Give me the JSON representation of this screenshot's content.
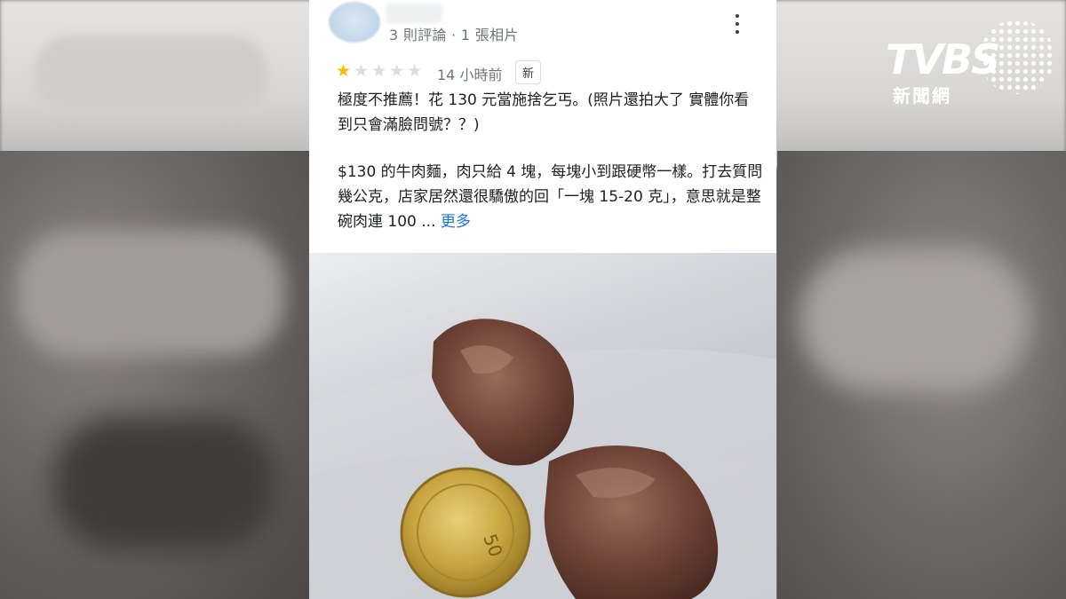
{
  "review": {
    "meta": "3 則評論 · 1 張相片",
    "rating": 1,
    "max_rating": 5,
    "time": "14 小時前",
    "badge": "新",
    "text_line1": "極度不推薦！花 130 元當施捨乞丐。(照片還拍大了 實體你看到只會滿臉問號？？)",
    "text_line2": "$130 的牛肉麵，肉只給 4 塊，每塊小到跟硬幣一樣。打去質問幾公克，店家居然還很驕傲的回「一塊 15-20 克」，意思就是整碗肉連 100 ...",
    "more_label": "更多",
    "menu_icon": "more-vert-icon"
  },
  "logo": {
    "brand": "TVBS",
    "subtitle": "新聞網"
  },
  "photo": {
    "coin_text": "50"
  },
  "colors": {
    "star": "#fbbc04",
    "link": "#1a73e8",
    "meta": "#70757a"
  }
}
